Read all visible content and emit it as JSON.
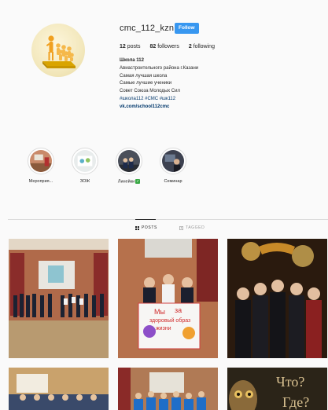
{
  "profile": {
    "username": "cmc_112_kzn",
    "follow_label": "Follow",
    "stats": [
      {
        "value": "12",
        "label": "posts"
      },
      {
        "value": "82",
        "label": "followers"
      },
      {
        "value": "2",
        "label": "following"
      }
    ],
    "bio": {
      "name": "Школа 112",
      "lines": [
        "Авиастроительного района г.Казани",
        "Самая лучшая школа",
        "Самые лучшие ученики",
        "Совет Союза Молодых Сил"
      ],
      "hashtags": "#школа112 #СМС #шк112",
      "link": "vk.com/school112cmc"
    }
  },
  "highlights": [
    {
      "label": "Мероприя..."
    },
    {
      "label": "ЗОЖ"
    },
    {
      "label": "Линейки",
      "badge": "✓"
    },
    {
      "label": "Семинар"
    }
  ],
  "tabs": [
    {
      "label": "POSTS",
      "icon": "grid-icon",
      "active": true
    },
    {
      "label": "TAGGED",
      "icon": "tag-icon",
      "active": false
    }
  ],
  "posts": [
    {
      "alt": "assembly-hall-students-in-line"
    },
    {
      "alt": "students-with-healthy-lifestyle-poster"
    },
    {
      "alt": "students-group-at-theater"
    },
    {
      "alt": "assembly-hall-audience"
    },
    {
      "alt": "students-in-blue-shirts"
    },
    {
      "alt": "chto-gde-kogda-game"
    }
  ],
  "post_overlay_text": {
    "line1": "Что?",
    "line2": "Где?"
  },
  "poster_text": {
    "line1": "Мы",
    "line2": "за",
    "line3": "здоровый образ",
    "line4": "жизни"
  },
  "colors": {
    "follow_button": "#3897f0",
    "link": "#00376b",
    "check_badge": "#3aa845"
  }
}
